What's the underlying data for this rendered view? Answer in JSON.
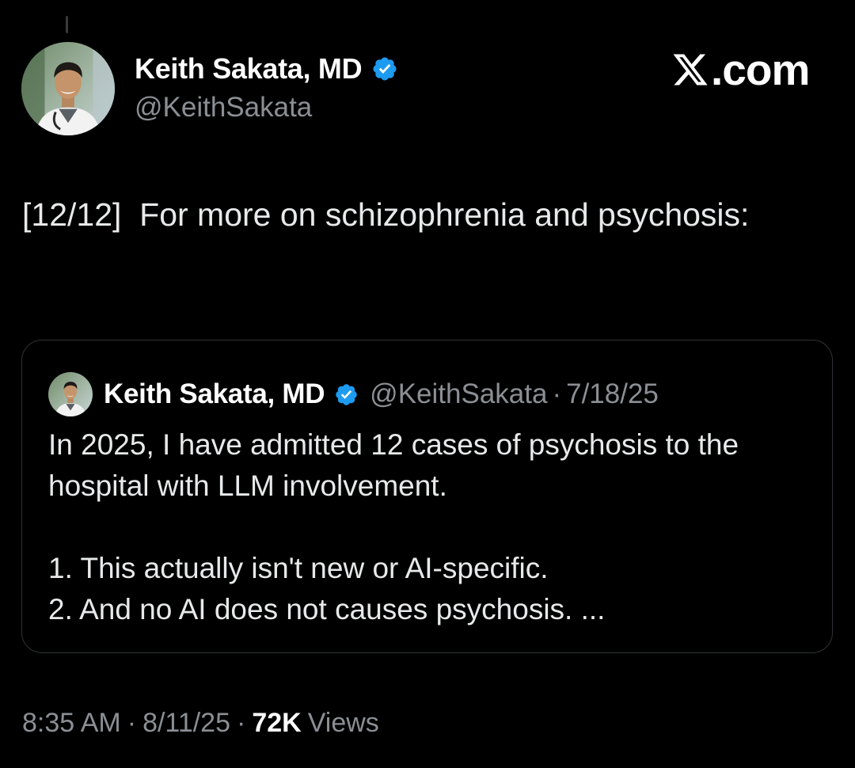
{
  "post": {
    "author": {
      "name": "Keith Sakata, MD",
      "handle": "@KeithSakata",
      "verified": true,
      "avatar_icon": "profile-photo"
    },
    "site": {
      "logo_icon": "x-logo-icon",
      "label": ".com"
    },
    "text": "[12/12]  For more on schizophrenia and psychosis:",
    "quote": {
      "author": {
        "name": "Keith Sakata, MD",
        "handle": "@KeithSakata",
        "verified": true
      },
      "separator": "·",
      "date": "7/18/25",
      "paragraphs": [
        "In 2025, I have admitted 12 cases of psychosis to the hospital with LLM involvement.",
        "1. This actually isn't new or AI-specific.",
        "2. And no AI does not causes psychosis. ..."
      ]
    },
    "meta": {
      "time": "8:35 AM",
      "separator": "·",
      "date": "8/11/25",
      "views_count": "72K",
      "views_label": "Views"
    }
  },
  "colors": {
    "background": "#000000",
    "text_primary": "#ffffff",
    "text_body": "#e7e9ea",
    "text_secondary": "#8b8f94",
    "verified_blue": "#1d9bf0",
    "card_border": "#2f3336"
  }
}
